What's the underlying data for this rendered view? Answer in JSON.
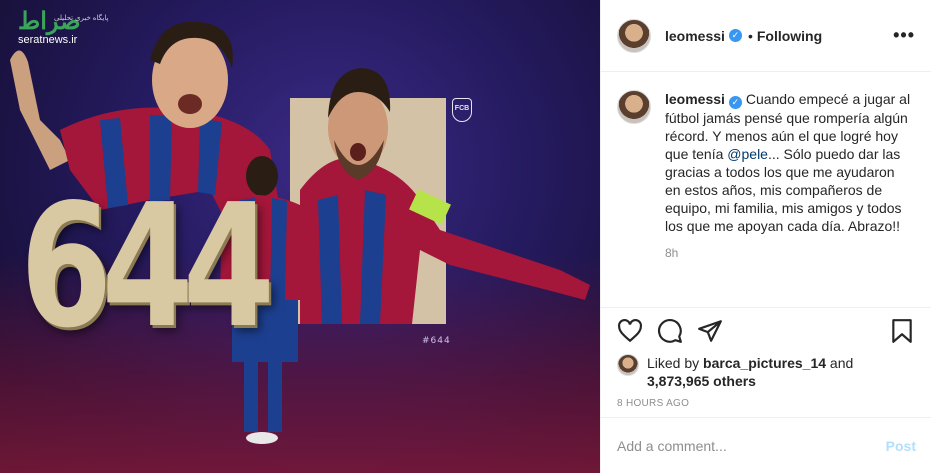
{
  "image": {
    "big_number": "644",
    "hashtag": "#644",
    "watermark_url": "seratnews.ir",
    "watermark_logo": "صراط",
    "watermark_sub": "پایگاه خبری تحلیلی",
    "crest_text": "FCB"
  },
  "header": {
    "username": "leomessi",
    "verified_icon": "✓",
    "separator": "•",
    "follow_status": "Following",
    "more_icon": "•••"
  },
  "caption": {
    "username": "leomessi",
    "verified_icon": "✓",
    "text_before_mention": "Cuando empecé a jugar al fútbol jamás pensé que rompería algún récord. Y menos aún el que logré hoy que tenía",
    "mention": "@pele",
    "text_after_mention": "... Sólo puedo dar las gracias a todos los que me ayudaron en estos años, mis compañeros de equipo, mi familia, mis amigos y todos los que me apoyan cada día. Abrazo!!",
    "time_ago": "8h"
  },
  "actions": {
    "like": "heart-icon",
    "comment": "comment-icon",
    "share": "share-icon",
    "save": "bookmark-icon"
  },
  "likes": {
    "prefix": "Liked by",
    "user": "barca_pictures_14",
    "and": "and",
    "others": "3,873,965 others"
  },
  "timestamp": "8 HOURS AGO",
  "comment": {
    "placeholder": "Add a comment...",
    "post_label": "Post"
  },
  "colors": {
    "verified_blue": "#3897f0",
    "post_disabled": "#b2dffc",
    "gold_number": "#d9c9a3",
    "image_bg": "#241a5e"
  }
}
